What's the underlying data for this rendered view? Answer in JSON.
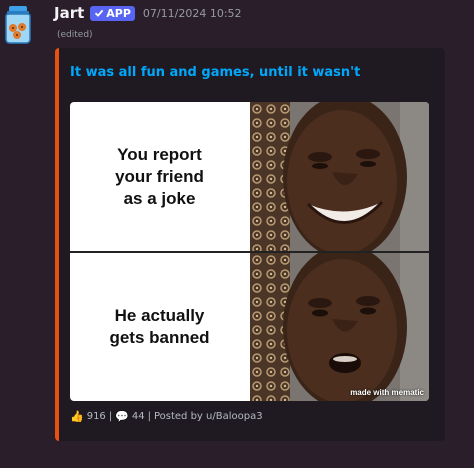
{
  "message": {
    "username": "Jart",
    "app_badge": "APP",
    "timestamp": "07/11/2024 10:52",
    "edited": "(edited)",
    "avatar_icon": "jar-icon"
  },
  "embed": {
    "accent_color": "#e8510f",
    "title": "It was all fun and games, until it wasn't",
    "meme": {
      "top_text_line1": "You report",
      "top_text_line2": "your friend",
      "top_text_line3": "as a joke",
      "bottom_text_line1": "He actually",
      "bottom_text_line2": "gets banned",
      "watermark": "made with mematic"
    },
    "footer": {
      "upvotes": "916",
      "comments": "44",
      "posted_by": "Posted by u/Baloopa3",
      "separator": "|"
    }
  }
}
